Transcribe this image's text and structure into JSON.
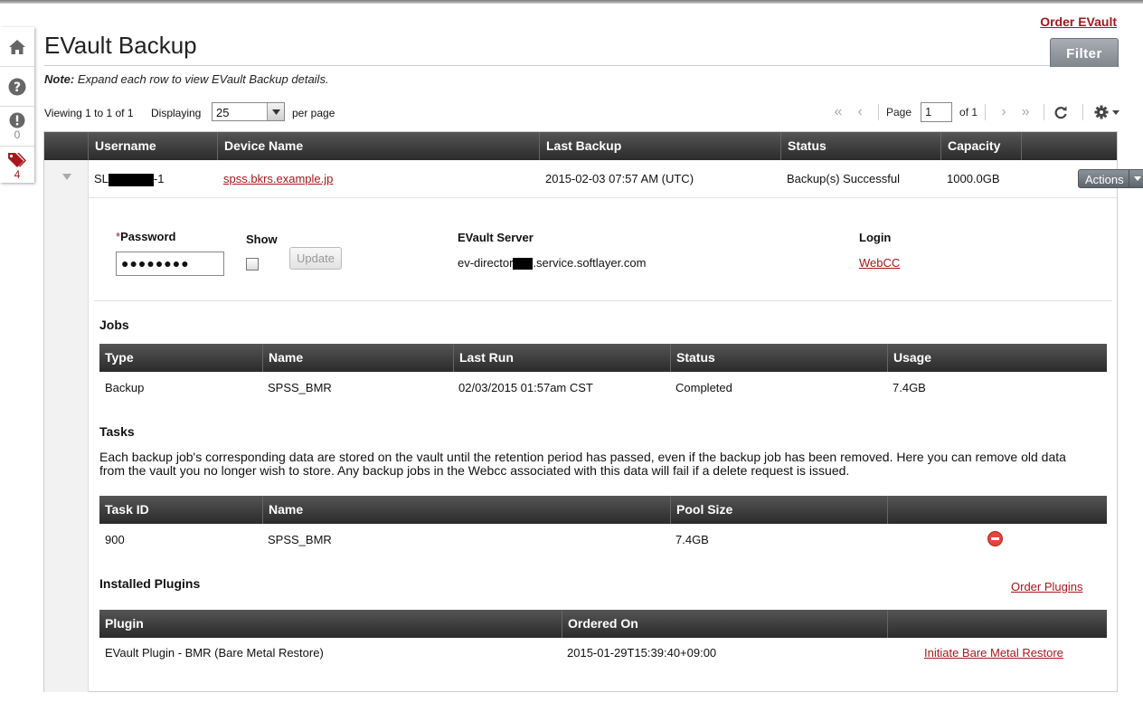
{
  "header": {
    "title": "EVault Backup",
    "order_link": "Order EVault",
    "filter_label": "Filter",
    "note_prefix": "Note:",
    "note_text": " Expand each row to view EVault Backup details."
  },
  "rail": {
    "items": [
      {
        "icon": "home-icon"
      },
      {
        "icon": "help-icon"
      },
      {
        "icon": "alert-icon",
        "count": "0"
      },
      {
        "icon": "tags-icon",
        "count": "4"
      }
    ]
  },
  "toolbar": {
    "viewing": "Viewing 1 to 1 of 1",
    "displaying": "Displaying",
    "per_page_value": "25",
    "per_page": "per page",
    "page_label": "Page",
    "page_value": "1",
    "of_pages": "of 1"
  },
  "table": {
    "columns": [
      "Username",
      "Device Name",
      "Last Backup",
      "Status",
      "Capacity"
    ],
    "row": {
      "username_prefix": "SL",
      "username_suffix": "-1",
      "device": "spss.bkrs.example.jp",
      "last_backup": "2015-02-03 07:57 AM (UTC)",
      "status": "Backup(s) Successful",
      "capacity": "1000.0GB",
      "actions": "Actions"
    }
  },
  "detail": {
    "password_label": "Password",
    "password_value": "●●●●●●●●",
    "show_label": "Show",
    "update_label": "Update",
    "server_label": "EVault Server",
    "server_prefix": "ev-director",
    "server_suffix": ".service.softlayer.com",
    "login_label": "Login",
    "login_link": "WebCC",
    "accent": "#a8171b"
  },
  "jobs": {
    "title": "Jobs",
    "columns": [
      "Type",
      "Name",
      "Last Run",
      "Status",
      "Usage"
    ],
    "rows": [
      [
        "Backup",
        "SPSS_BMR",
        "02/03/2015 01:57am CST",
        "Completed",
        "7.4GB"
      ]
    ]
  },
  "tasks": {
    "title": "Tasks",
    "description": "Each backup job's corresponding data are stored on the vault until the retention period has passed, even if the backup job has been removed. Here you can remove old data from the vault you no longer wish to store. Any backup jobs in the Webcc associated with this data will fail if a delete request is issued.",
    "columns": [
      "Task ID",
      "Name",
      "Pool Size"
    ],
    "rows": [
      [
        "900",
        "SPSS_BMR",
        "7.4GB"
      ]
    ]
  },
  "plugins": {
    "title": "Installed Plugins",
    "order_link": "Order Plugins",
    "columns": [
      "Plugin",
      "Ordered On"
    ],
    "rows": [
      {
        "plugin": "EVault Plugin - BMR (Bare Metal Restore)",
        "ordered_on": "2015-01-29T15:39:40+09:00",
        "action": "Initiate Bare Metal Restore"
      }
    ]
  }
}
